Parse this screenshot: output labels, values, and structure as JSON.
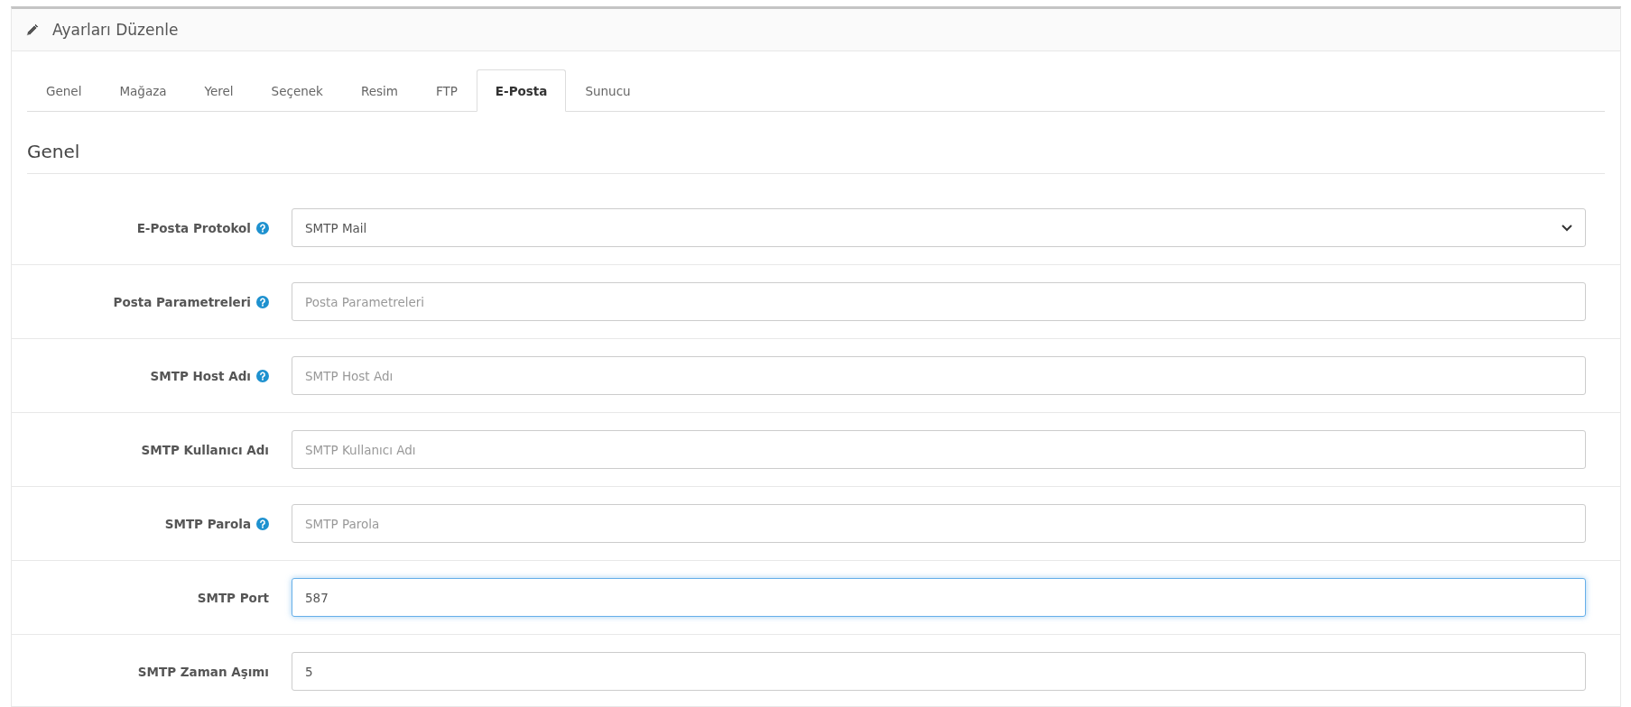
{
  "panel": {
    "title": "Ayarları Düzenle"
  },
  "tabs": [
    {
      "label": "Genel",
      "selected": false
    },
    {
      "label": "Mağaza",
      "selected": false
    },
    {
      "label": "Yerel",
      "selected": false
    },
    {
      "label": "Seçenek",
      "selected": false
    },
    {
      "label": "Resim",
      "selected": false
    },
    {
      "label": "FTP",
      "selected": false
    },
    {
      "label": "E-Posta",
      "selected": true
    },
    {
      "label": "Sunucu",
      "selected": false
    }
  ],
  "section": {
    "title": "Genel"
  },
  "fields": [
    {
      "kind": "select",
      "label": "E-Posta Protokol",
      "help": true,
      "value": "SMTP Mail",
      "focused": false
    },
    {
      "kind": "input",
      "label": "Posta Parametreleri",
      "help": true,
      "placeholder": "Posta Parametreleri",
      "focused": false
    },
    {
      "kind": "input",
      "label": "SMTP Host Adı",
      "help": true,
      "placeholder": "SMTP Host Adı",
      "focused": false
    },
    {
      "kind": "input",
      "label": "SMTP Kullanıcı Adı",
      "help": false,
      "placeholder": "SMTP Kullanıcı Adı",
      "focused": false
    },
    {
      "kind": "input",
      "label": "SMTP Parola",
      "help": true,
      "placeholder": "SMTP Parola",
      "focused": false
    },
    {
      "kind": "input",
      "label": "SMTP Port",
      "help": false,
      "value": "587",
      "focused": true
    },
    {
      "kind": "input",
      "label": "SMTP Zaman Aşımı",
      "help": false,
      "value": "5",
      "focused": false
    }
  ]
}
